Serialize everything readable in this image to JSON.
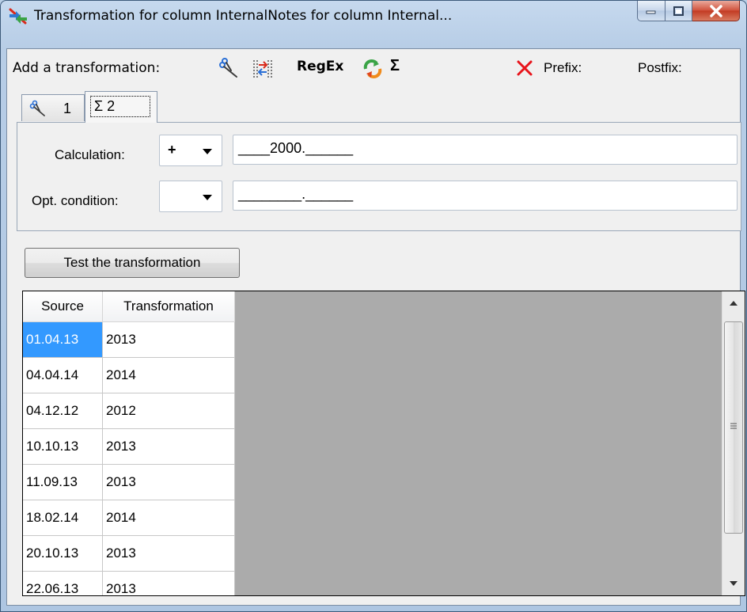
{
  "window": {
    "title": "Transformation for column InternalNotes for column Internal..."
  },
  "toolbar": {
    "label": "Add a transformation:",
    "regex": "RegEx",
    "sigma": "Σ",
    "prefix": "Prefix:",
    "postfix": "Postfix:"
  },
  "tabs": [
    {
      "label": "1",
      "icon": "scissors-icon"
    },
    {
      "label": "Σ 2",
      "icon": "sigma-icon"
    }
  ],
  "form": {
    "calculation": {
      "label": "Calculation:",
      "operator": "+",
      "value": "____2000.______"
    },
    "condition": {
      "label": "Opt. condition:",
      "operator": "",
      "value": "________.______"
    }
  },
  "test_button": "Test the transformation",
  "grid": {
    "headers": [
      "Source",
      "Transformation"
    ],
    "rows": [
      [
        "01.04.13",
        "2013"
      ],
      [
        "04.04.14",
        "2014"
      ],
      [
        "04.12.12",
        "2012"
      ],
      [
        "10.10.13",
        "2013"
      ],
      [
        "11.09.13",
        "2013"
      ],
      [
        "18.02.14",
        "2014"
      ],
      [
        "20.10.13",
        "2013"
      ],
      [
        "22.06.13",
        "2013"
      ]
    ]
  },
  "colors": {
    "selection": "#3399ff",
    "grid_empty": "#ababab",
    "delete_x": "#e8141b"
  }
}
